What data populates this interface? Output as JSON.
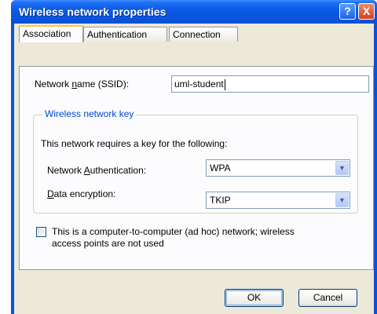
{
  "window": {
    "title": "Wireless network properties",
    "help_label": "?",
    "close_label": "X"
  },
  "tabs": [
    {
      "label": "Association",
      "active": true
    },
    {
      "label": "Authentication",
      "active": false
    },
    {
      "label": "Connection",
      "active": false
    }
  ],
  "association": {
    "ssid_label_pre": "Network ",
    "ssid_label_accel": "n",
    "ssid_label_post": "ame (SSID):",
    "ssid_value": "uml-student",
    "key_group_title": "Wireless network key",
    "key_description": "This network requires a key for the following:",
    "auth_label_pre": "Network ",
    "auth_label_accel": "A",
    "auth_label_post": "uthentication:",
    "auth_value": "WPA",
    "enc_label_pre": "",
    "enc_label_accel": "D",
    "enc_label_post": "ata encryption:",
    "enc_value": "TKIP",
    "adhoc_label_line1": "This is a computer-to-computer (ad hoc) network; wireless",
    "adhoc_label_line2": "access points are not used",
    "adhoc_checked": false
  },
  "buttons": {
    "ok": "OK",
    "cancel": "Cancel"
  },
  "colors": {
    "titlebar": "#0a55dd",
    "dialog_bg": "#ece9d8",
    "group_title": "#0046d5",
    "active_tab_highlight": "#ffc83c"
  },
  "icons": {
    "combo_arrow": "chevron-down-icon"
  }
}
